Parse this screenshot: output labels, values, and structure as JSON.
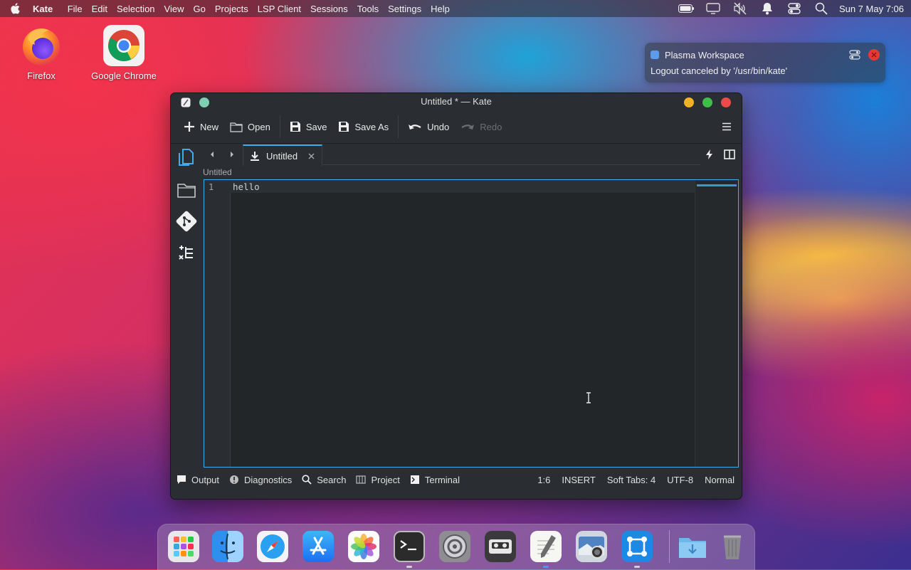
{
  "menubar": {
    "app_name": "Kate",
    "items": [
      "File",
      "Edit",
      "Selection",
      "View",
      "Go",
      "Projects",
      "LSP Client",
      "Sessions",
      "Tools",
      "Settings",
      "Help"
    ],
    "clock": "Sun 7 May 7:06"
  },
  "desktop_icons": [
    {
      "label": "Firefox"
    },
    {
      "label": "Google Chrome"
    }
  ],
  "notification": {
    "app": "Plasma Workspace",
    "message": "Logout canceled by '/usr/bin/kate'"
  },
  "window": {
    "title": "Untitled * — Kate",
    "toolbar": {
      "new_label": "New",
      "open_label": "Open",
      "save_label": "Save",
      "save_as_label": "Save As",
      "undo_label": "Undo",
      "redo_label": "Redo"
    },
    "tab": {
      "label": "Untitled"
    },
    "breadcrumb": "Untitled",
    "editor": {
      "line_number": "1",
      "content": "hello"
    },
    "statusbar": {
      "output_label": "Output",
      "diagnostics_label": "Diagnostics",
      "search_label": "Search",
      "project_label": "Project",
      "terminal_label": "Terminal",
      "cursor_pos": "1:6",
      "mode": "INSERT",
      "indent": "Soft Tabs: 4",
      "encoding": "UTF-8",
      "input_mode": "Normal"
    }
  },
  "colors": {
    "accent": "#3daee9",
    "window_bg": "#2a2e32",
    "editor_bg": "#232629",
    "close": "#ed4b4b",
    "minimize": "#f0b323",
    "maximize": "#3fbf4a"
  },
  "dock": {
    "items": [
      "launchpad-icon",
      "finder-icon",
      "safari-icon",
      "app-store-icon",
      "photos-icon",
      "terminal-icon",
      "system-settings-icon",
      "cassette-icon",
      "kate-editor-icon",
      "screenshot-icon",
      "network-icon",
      "downloads-folder-icon",
      "trash-icon"
    ]
  }
}
